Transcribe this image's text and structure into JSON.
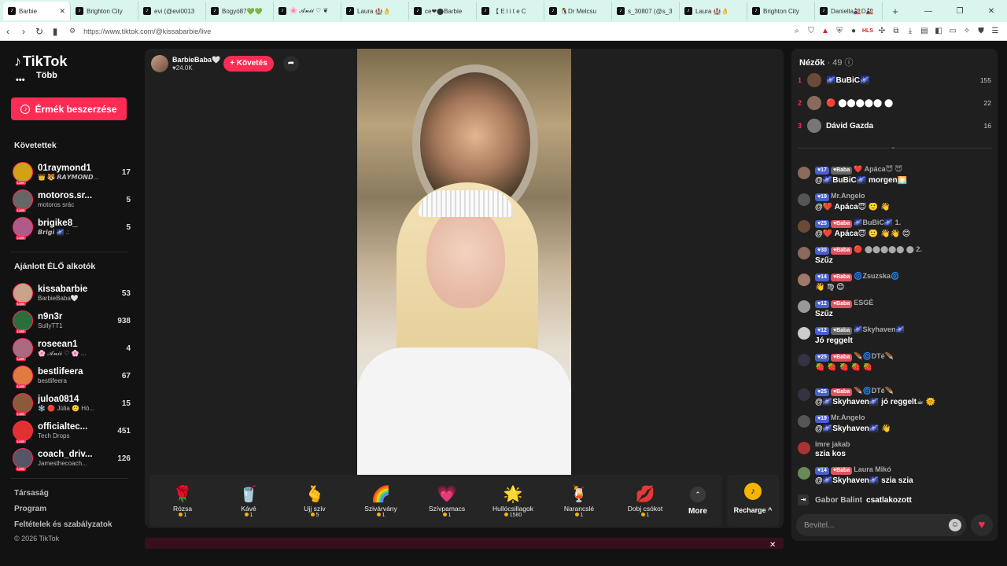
{
  "browser": {
    "tabs": [
      {
        "label": "Barbie",
        "active": true
      },
      {
        "label": "Brighton City"
      },
      {
        "label": "evi (@evi0013"
      },
      {
        "label": "Bogyó87💚💚"
      },
      {
        "label": "🌸 𝓐𝓷𝓲𝓲 ♡ ❦"
      },
      {
        "label": "Laura 🏰👌"
      },
      {
        "label": "ce❤⬤Barbie"
      },
      {
        "label": "【 E l i t e C"
      },
      {
        "label": "🐧Dr Melcsu"
      },
      {
        "label": "s_30807 (@s_3"
      },
      {
        "label": "Laura 🏰👌"
      },
      {
        "label": "Brighton City"
      },
      {
        "label": "Daniella🎎D🎎"
      }
    ],
    "new_tab": "+",
    "url": "https://www.tiktok.com/@kissabarbie/live",
    "ext_hls": "HLS"
  },
  "sidebar": {
    "logo": "TikTok",
    "more_label": "Több",
    "coin_button": "Érmék beszerzése",
    "following_title": "Követettek",
    "following": [
      {
        "name": "01raymond1",
        "sub": "👑 🐯 𝙍𝘼𝙔𝙈𝙊𝙉𝘿...",
        "count": "17",
        "color": "#d4a017"
      },
      {
        "name": "motoros.sr...",
        "sub": "motoros srác",
        "count": "5",
        "color": "#666"
      },
      {
        "name": "brigike8_",
        "sub": "𝘽𝙧𝙞𝙜𝙞 🌌 .:",
        "count": "5",
        "color": "#b05a8a"
      }
    ],
    "recommended_title": "Ajánlott ÉLŐ alkotók",
    "recommended": [
      {
        "name": "kissabarbie",
        "sub": "BarbieBaba🤍",
        "count": "53",
        "color": "#c9a38a"
      },
      {
        "name": "n9n3r",
        "sub": "SullyTT1",
        "count": "938",
        "color": "#2b6e3b"
      },
      {
        "name": "roseean1",
        "sub": "🌸 𝓐𝓷𝓲𝓲 ♡ 🌸 ...",
        "count": "4",
        "color": "#a86b80"
      },
      {
        "name": "bestlifeera",
        "sub": "bestlifeera",
        "count": "67",
        "color": "#e07a3f"
      },
      {
        "name": "juloa0814",
        "sub": "❄️ 🔴 Júlia 🙂 Hó...",
        "count": "15",
        "color": "#8a5a3a"
      },
      {
        "name": "officialtec...",
        "sub": "Tech Drops",
        "count": "451",
        "color": "#e0302f"
      },
      {
        "name": "coach_driv...",
        "sub": "Jamesthecoach...",
        "count": "126",
        "color": "#556"
      }
    ],
    "footer": [
      "Társaság",
      "Program",
      "Feltételek és szabályzatok"
    ],
    "copyright": "© 2026 TikTok"
  },
  "stage": {
    "host_name": "BarbieBaba🤍",
    "host_likes": "24.0K",
    "follow_label": "+ Követés",
    "gifts": [
      {
        "icon": "🌹",
        "name": "Rózsa",
        "price": "1"
      },
      {
        "icon": "🥤",
        "name": "Kávé",
        "price": "1"
      },
      {
        "icon": "🫰",
        "name": "Ujj szív",
        "price": "5"
      },
      {
        "icon": "🌈",
        "name": "Szivárvány",
        "price": "1"
      },
      {
        "icon": "💗",
        "name": "Szívpamacs",
        "price": "1"
      },
      {
        "icon": "🌟",
        "name": "Hullócsillagok",
        "price": "1580"
      },
      {
        "icon": "🍹",
        "name": "Narancslé",
        "price": "1"
      },
      {
        "icon": "💋",
        "name": "Dobj csókot",
        "price": "1"
      }
    ],
    "more_label": "More",
    "recharge_label": "Recharge ^"
  },
  "chat": {
    "viewers_label": "Nézők",
    "viewers_count": "· 49",
    "top_viewers": [
      {
        "rank": "1",
        "name": "🌌BuBiC🌌",
        "score": "155",
        "color": "#6b4a3a"
      },
      {
        "rank": "2",
        "name": "🔴 ⬤⬤⬤⬤⬤ ⬤",
        "score": "22",
        "color": "#8a6a5a"
      },
      {
        "rank": "3",
        "name": "Dávid Gazda",
        "score": "16",
        "color": "#777"
      }
    ],
    "messages": [
      {
        "lvl": "17",
        "fan": "Baba",
        "fan_grey": true,
        "user": "❤️ Apáca😇 😇",
        "text": "@🌌BuBiC🌌 morgen🌅",
        "color": "#8a6a5a"
      },
      {
        "lvl": "19",
        "fan": "",
        "user": "Mr.Angelo",
        "text": "@❤️ Apáca😇 🙂 👋",
        "color": "#555"
      },
      {
        "lvl": "25",
        "fan": "Baba",
        "user": "🌌BuBiC🌌 1.",
        "text": "@❤️ Apáca😇 🙂 👋👋 😊",
        "color": "#6b4a3a"
      },
      {
        "lvl": "30",
        "fan": "Baba",
        "user": "🔴 ⬤⬤⬤⬤⬤ ⬤ 2.",
        "text": "Szűz",
        "color": "#8a6a5a"
      },
      {
        "lvl": "14",
        "fan": "Baba",
        "user": "🌀Zsuzska🌀",
        "text": "👋 ♍ 😊",
        "color": "#a0786a"
      },
      {
        "lvl": "12",
        "fan": "Baba",
        "user": "ESGÉ",
        "text": "Szűz",
        "color": "#999"
      },
      {
        "lvl": "12",
        "fan": "Baba",
        "fan_grey": true,
        "user": "🌌Skyhaven🌌",
        "text": "Jó reggelt",
        "color": "#ccc"
      },
      {
        "lvl": "25",
        "fan": "Baba",
        "user": "🪶🌀DTé🪶",
        "text": "🍓 🍓 🍓 🍓 🍓",
        "color": "#334"
      },
      {
        "lvl": "25",
        "fan": "Baba",
        "user": "🪶🌀DTé🪶",
        "text": "@🌌Skyhaven🌌 jó reggelt☕ 🌞",
        "color": "#334"
      },
      {
        "lvl": "19",
        "fan": "",
        "user": "Mr.Angelo",
        "text": "@🌌Skyhaven🌌 👋",
        "color": "#555"
      },
      {
        "lvl": "",
        "fan": "",
        "user": "imre jakab",
        "text": "szia kos",
        "color": "#a33"
      },
      {
        "lvl": "14",
        "fan": "Baba",
        "user": "Laura Mikó",
        "text": "@🌌Skyhaven🌌 szia szia",
        "color": "#6a8a5a"
      }
    ],
    "join_name": "Gabor Balint",
    "join_text": "csatlakozott",
    "input_placeholder": "Bevitel..."
  }
}
